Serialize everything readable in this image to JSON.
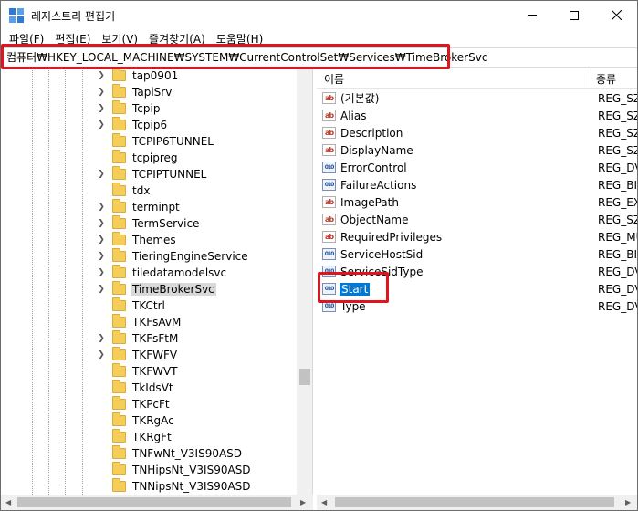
{
  "window": {
    "title": "레지스트리 편집기",
    "controls": {
      "minimize": "–",
      "maximize": "□",
      "close": "✕"
    }
  },
  "menu": [
    "파일(F)",
    "편집(E)",
    "보기(V)",
    "즐겨찾기(A)",
    "도움말(H)"
  ],
  "address": "컴퓨터₩HKEY_LOCAL_MACHINE₩SYSTEM₩CurrentControlSet₩Services₩TimeBrokerSvc",
  "tree": {
    "items": [
      {
        "label": "tap0901",
        "expandable": true,
        "selected": false
      },
      {
        "label": "TapiSrv",
        "expandable": true,
        "selected": false
      },
      {
        "label": "Tcpip",
        "expandable": true,
        "selected": false
      },
      {
        "label": "Tcpip6",
        "expandable": true,
        "selected": false
      },
      {
        "label": "TCPIP6TUNNEL",
        "expandable": false,
        "selected": false
      },
      {
        "label": "tcpipreg",
        "expandable": false,
        "selected": false
      },
      {
        "label": "TCPIPTUNNEL",
        "expandable": true,
        "selected": false
      },
      {
        "label": "tdx",
        "expandable": false,
        "selected": false
      },
      {
        "label": "terminpt",
        "expandable": true,
        "selected": false
      },
      {
        "label": "TermService",
        "expandable": true,
        "selected": false
      },
      {
        "label": "Themes",
        "expandable": true,
        "selected": false
      },
      {
        "label": "TieringEngineService",
        "expandable": true,
        "selected": false
      },
      {
        "label": "tiledatamodelsvc",
        "expandable": true,
        "selected": false
      },
      {
        "label": "TimeBrokerSvc",
        "expandable": true,
        "selected": true
      },
      {
        "label": "TKCtrl",
        "expandable": false,
        "selected": false
      },
      {
        "label": "TKFsAvM",
        "expandable": false,
        "selected": false
      },
      {
        "label": "TKFsFtM",
        "expandable": true,
        "selected": false
      },
      {
        "label": "TKFWFV",
        "expandable": true,
        "selected": false
      },
      {
        "label": "TKFWVT",
        "expandable": false,
        "selected": false
      },
      {
        "label": "TkIdsVt",
        "expandable": false,
        "selected": false
      },
      {
        "label": "TKPcFt",
        "expandable": false,
        "selected": false
      },
      {
        "label": "TKRgAc",
        "expandable": false,
        "selected": false
      },
      {
        "label": "TKRgFt",
        "expandable": false,
        "selected": false
      },
      {
        "label": "TNFwNt_V3IS90ASD",
        "expandable": false,
        "selected": false
      },
      {
        "label": "TNHipsNt_V3IS90ASD",
        "expandable": false,
        "selected": false
      },
      {
        "label": "TNNipsNt_V3IS90ASD",
        "expandable": false,
        "selected": false
      }
    ]
  },
  "list": {
    "columns": {
      "name": "이름",
      "type": "종류"
    },
    "values": [
      {
        "name": "(기본값)",
        "type": "REG_SZ",
        "icon": "ab"
      },
      {
        "name": "Alias",
        "type": "REG_SZ",
        "icon": "ab"
      },
      {
        "name": "Description",
        "type": "REG_SZ",
        "icon": "ab"
      },
      {
        "name": "DisplayName",
        "type": "REG_SZ",
        "icon": "ab"
      },
      {
        "name": "ErrorControl",
        "type": "REG_DV",
        "icon": "bin"
      },
      {
        "name": "FailureActions",
        "type": "REG_BIN",
        "icon": "bin"
      },
      {
        "name": "ImagePath",
        "type": "REG_EXI",
        "icon": "ab"
      },
      {
        "name": "ObjectName",
        "type": "REG_SZ",
        "icon": "ab"
      },
      {
        "name": "RequiredPrivileges",
        "type": "REG_MU",
        "icon": "ab"
      },
      {
        "name": "ServiceHostSid",
        "type": "REG_BIN",
        "icon": "bin"
      },
      {
        "name": "ServiceSidType",
        "type": "REG_DV",
        "icon": "bin"
      },
      {
        "name": "Start",
        "type": "REG_DV",
        "icon": "bin",
        "selected": true
      },
      {
        "name": "Type",
        "type": "REG_DV",
        "icon": "bin"
      }
    ]
  },
  "icons": {
    "ab": "ab",
    "bin": "010"
  },
  "colors": {
    "highlight": "#e0141e",
    "selection": "#0078d7",
    "folder": "#f5cd59"
  }
}
